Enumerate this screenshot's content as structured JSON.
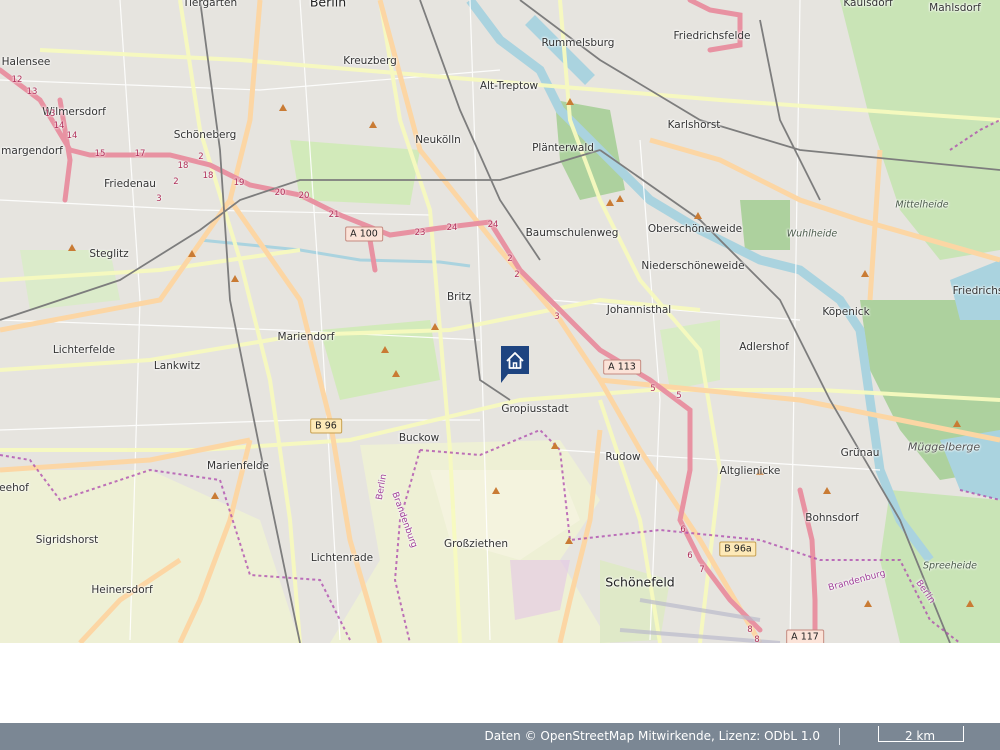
{
  "map": {
    "places": [
      {
        "name": "Tiergarten"
      },
      {
        "name": "Berlin"
      },
      {
        "name": "Kaulsdorf"
      },
      {
        "name": "Mahlsdorf"
      },
      {
        "name": "Rummelsburg"
      },
      {
        "name": "Friedrichsfelde"
      },
      {
        "name": "Halensee"
      },
      {
        "name": "Kreuzberg"
      },
      {
        "name": "Alt-Treptow"
      },
      {
        "name": "Wilmersdorf"
      },
      {
        "name": "Schöneberg"
      },
      {
        "name": "Neukölln"
      },
      {
        "name": "Karlshorst"
      },
      {
        "name": "Plänterwald"
      },
      {
        "name": "margendorf"
      },
      {
        "name": "Friedenau"
      },
      {
        "name": "Baumschulenweg"
      },
      {
        "name": "Oberschöneweide"
      },
      {
        "name": "Steglitz"
      },
      {
        "name": "Niederschöneweide"
      },
      {
        "name": "Britz"
      },
      {
        "name": "Johannisthal"
      },
      {
        "name": "Köpenick"
      },
      {
        "name": "Friedrichs"
      },
      {
        "name": "Lichterfelde"
      },
      {
        "name": "Mariendorf"
      },
      {
        "name": "Adlershof"
      },
      {
        "name": "Lankwitz"
      },
      {
        "name": "Gropiusstadt"
      },
      {
        "name": "Buckow"
      },
      {
        "name": "Rudow"
      },
      {
        "name": "Grünau"
      },
      {
        "name": "Marienfelde"
      },
      {
        "name": "Altglienicke"
      },
      {
        "name": "eehof"
      },
      {
        "name": "Bohnsdorf"
      },
      {
        "name": "Sigridshorst"
      },
      {
        "name": "Großziethen"
      },
      {
        "name": "Lichtenrade"
      },
      {
        "name": "Schönefeld"
      },
      {
        "name": "Heinersdorf"
      }
    ],
    "natural_labels": [
      "Mittelheide",
      "Wuhlheide",
      "Müggelberge",
      "Spreeheide"
    ],
    "boundary_labels": [
      "Berlin",
      "Brandenburg",
      "Brandenburg",
      "Berlin"
    ],
    "road_shields": [
      "A 100",
      "A 113",
      "B 96",
      "B 96a",
      "A 117"
    ],
    "exit_numbers": [
      "12",
      "13",
      "13",
      "14",
      "14",
      "15",
      "17",
      "18",
      "18",
      "2",
      "2",
      "19",
      "20",
      "20",
      "21",
      "23",
      "24",
      "24",
      "2",
      "2",
      "3",
      "3",
      "5",
      "5",
      "6",
      "6",
      "7",
      "8",
      "8"
    ],
    "marker": {
      "icon": "home-icon",
      "color": "#1e4480"
    }
  },
  "footer": {
    "attribution": "Daten © OpenStreetMap Mitwirkende, Lizenz: ODbL 1.0",
    "scale_label": "2 km"
  },
  "colors": {
    "motorway": "#e892a2",
    "primary": "#fcd6a4",
    "secondary": "#f7fabf",
    "water": "#aad3df",
    "forest": "#add19e",
    "boundary": "#ac46ac"
  }
}
